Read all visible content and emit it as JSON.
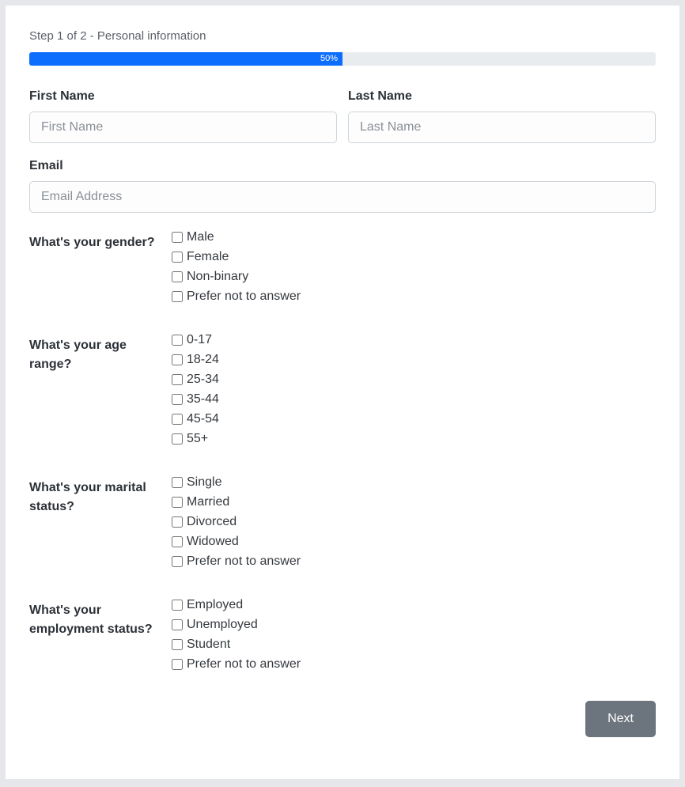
{
  "step_text": "Step 1 of 2 - Personal information",
  "progress": {
    "label": "50%",
    "width": "50%"
  },
  "first_name": {
    "label": "First Name",
    "placeholder": "First Name",
    "value": ""
  },
  "last_name": {
    "label": "Last Name",
    "placeholder": "Last Name",
    "value": ""
  },
  "email": {
    "label": "Email",
    "placeholder": "Email Address",
    "value": ""
  },
  "gender": {
    "question": "What's your gender?",
    "options": [
      "Male",
      "Female",
      "Non-binary",
      "Prefer not to answer"
    ]
  },
  "age": {
    "question": "What's your age range?",
    "options": [
      "0-17",
      "18-24",
      "25-34",
      "35-44",
      "45-54",
      "55+"
    ]
  },
  "marital": {
    "question": "What's your marital status?",
    "options": [
      "Single",
      "Married",
      "Divorced",
      "Widowed",
      "Prefer not to answer"
    ]
  },
  "employment": {
    "question": "What's your employment status?",
    "options": [
      "Employed",
      "Unemployed",
      "Student",
      "Prefer not to answer"
    ]
  },
  "next_button": "Next"
}
